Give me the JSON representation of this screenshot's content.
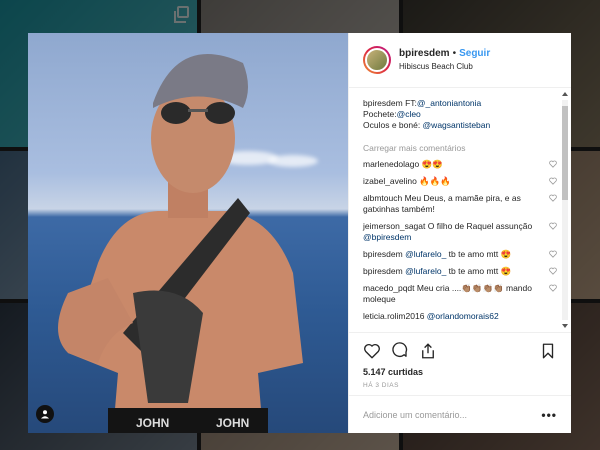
{
  "post": {
    "username": "bpiresdem",
    "follow_label": "Seguir",
    "location": "Hibiscus Beach Club",
    "caption": {
      "username": "bpiresdem",
      "line1_prefix": "FT:",
      "line1_mention": "@_antoniantonia",
      "line2_prefix": "Pochete:",
      "line2_mention": "@cleo",
      "line3_prefix": "Oculos e boné: ",
      "line3_mention": "@wagsantisteban"
    },
    "load_more_label": "Carregar mais comentários",
    "comments": [
      {
        "user": "marlenedolago",
        "text": "😍😍"
      },
      {
        "user": "izabel_avelino",
        "text": "🔥🔥🔥"
      },
      {
        "user": "albmtouch",
        "text": "Meu Deus, a mamãe pira, e as gatxinhas também!"
      },
      {
        "user": "jeimerson_sagat",
        "text": "O filho de Raquel assunção ",
        "mention": "@bpiresdem"
      },
      {
        "user": "bpiresdem",
        "mention": "@lufarelo_",
        "text": " tb te amo mtt 😍"
      },
      {
        "user": "bpiresdem",
        "mention": "@lufarelo_",
        "text": " tb te amo mtt 😍"
      },
      {
        "user": "macedo_pqdt",
        "text": "Meu cria ....👏🏽👏🏽👏🏽👏🏽 mando moleque"
      },
      {
        "user": "leticia.rolim2016",
        "mention": "@orlandomorais62",
        "text": ""
      }
    ],
    "likes": "5.147 curtidas",
    "time_ago": "HÁ 3 DIAS",
    "comment_placeholder": "Adicione um comentário...",
    "more_label": "•••",
    "icons": {
      "like": "heart-icon",
      "comment": "comment-bubble-icon",
      "share": "share-icon",
      "save": "bookmark-icon",
      "tag": "user-tag-icon"
    },
    "colors": {
      "follow": "#3897f0",
      "mention": "#003569",
      "muted": "#999999"
    }
  }
}
